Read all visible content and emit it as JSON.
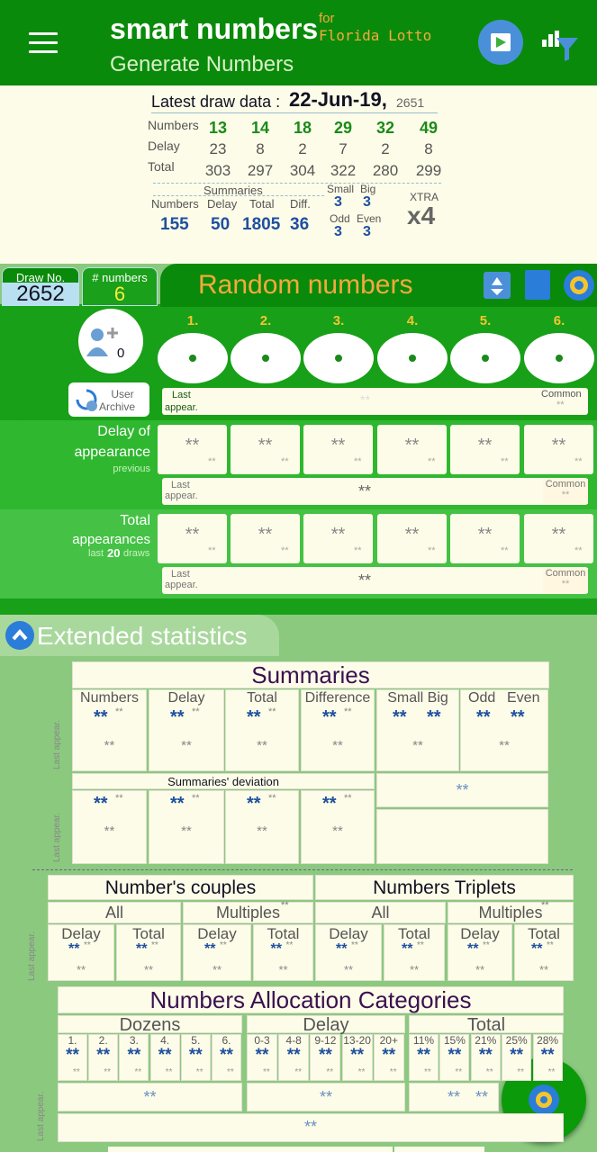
{
  "header": {
    "title": "smart numbers",
    "for": "for",
    "game": "Florida Lotto",
    "subtitle": "Generate Numbers"
  },
  "latest": {
    "label": "Latest draw data :",
    "date": "22-Jun-19,",
    "draw": "2651",
    "row_labels": [
      "Numbers",
      "Delay",
      "Total"
    ],
    "numbers": [
      "13",
      "14",
      "18",
      "29",
      "32",
      "49"
    ],
    "delay": [
      "23",
      "8",
      "2",
      "7",
      "2",
      "8"
    ],
    "total": [
      "303",
      "297",
      "304",
      "322",
      "280",
      "299"
    ],
    "summaries_label": "Summaries",
    "sum_labels": [
      "Numbers",
      "Delay",
      "Total",
      "Diff."
    ],
    "sum_values": [
      "155",
      "50",
      "1805",
      "36"
    ],
    "small_label": "Small",
    "big_label": "Big",
    "small": "3",
    "big": "3",
    "odd_label": "Odd",
    "even_label": "Even",
    "odd": "3",
    "even": "3",
    "xtra_label": "XTRA",
    "xtra": "x4"
  },
  "draw_tab": {
    "label": "Draw No.",
    "value": "2652"
  },
  "num_tab": {
    "label": "# numbers",
    "value": "6"
  },
  "random_title": "Random numbers",
  "positions": [
    "1.",
    "2.",
    "3.",
    "4.",
    "5.",
    "6."
  ],
  "user": {
    "count": "0",
    "archive1": "User",
    "archive2": "Archive"
  },
  "last_appear1": "Last",
  "last_appear2": "appear.",
  "common": "Common",
  "stars": "**",
  "delay_label1": "Delay of",
  "delay_label2": "appearance",
  "delay_label3": "previous",
  "total_label1": "Total",
  "total_label2": "appearances",
  "total_label3a": "last",
  "total_label3b": "20",
  "total_label3c": "draws",
  "ext_title": "Extended statistics",
  "summaries": {
    "title": "Summaries",
    "cols": [
      "Numbers",
      "Delay",
      "Total",
      "Difference",
      "Small Big",
      "Odd",
      "Even"
    ],
    "deviation": "Summaries' deviation",
    "last_appear": "Last appear."
  },
  "couples": {
    "title": "Number's couples",
    "all": "All",
    "multiples": "Multiples"
  },
  "triplets": {
    "title": "Numbers Triplets",
    "all": "All",
    "multiples": "Multiples"
  },
  "dt": {
    "delay": "Delay",
    "total": "Total"
  },
  "allocation": {
    "title": "Numbers Allocation Categories",
    "dozens": "Dozens",
    "delay": "Delay",
    "total": "Total",
    "dozen_cols": [
      "1.",
      "2.",
      "3.",
      "4.",
      "5.",
      "6."
    ],
    "delay_cols": [
      "0-3",
      "4-8",
      "9-12",
      "13-20",
      "20+"
    ],
    "total_cols": [
      "11%",
      "15%",
      "21%",
      "25%",
      "28%"
    ]
  }
}
